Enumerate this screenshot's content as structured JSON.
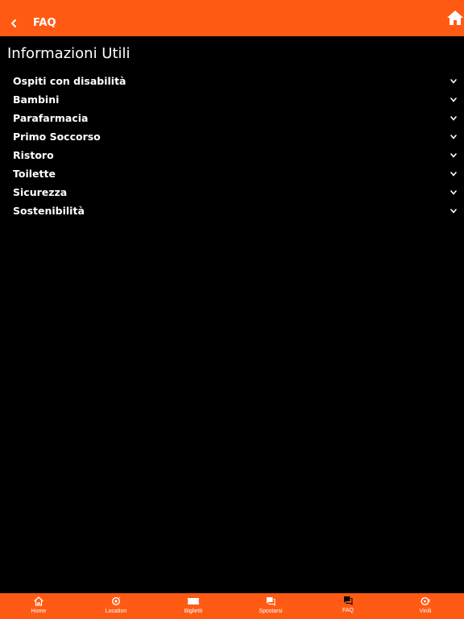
{
  "header": {
    "title": "FAQ",
    "back_icon": "chevron-left-icon",
    "home_icon": "home-icon",
    "color": "#ff5a14"
  },
  "page": {
    "title": "Informazioni Utili",
    "background": "#000000"
  },
  "faq": {
    "items": [
      {
        "label": "Ospiti con disabilità"
      },
      {
        "label": "Bambini"
      },
      {
        "label": "Parafarmacia"
      },
      {
        "label": "Primo Soccorso"
      },
      {
        "label": "Ristoro"
      },
      {
        "label": "Toilette"
      },
      {
        "label": "Sicurezza"
      },
      {
        "label": "Sostenibilità"
      }
    ],
    "expand_icon": "chevron-down-icon"
  },
  "tabbar": {
    "tabs": [
      {
        "label": "Home",
        "icon": "home-icon"
      },
      {
        "label": "Location",
        "icon": "location-icon"
      },
      {
        "label": "Biglietti",
        "icon": "ticket-icon"
      },
      {
        "label": "Spostarsi",
        "icon": "chat-icon"
      },
      {
        "label": "FAQ",
        "icon": "chat-icon"
      },
      {
        "label": "Vinili",
        "icon": "vinyl-icon"
      }
    ]
  }
}
